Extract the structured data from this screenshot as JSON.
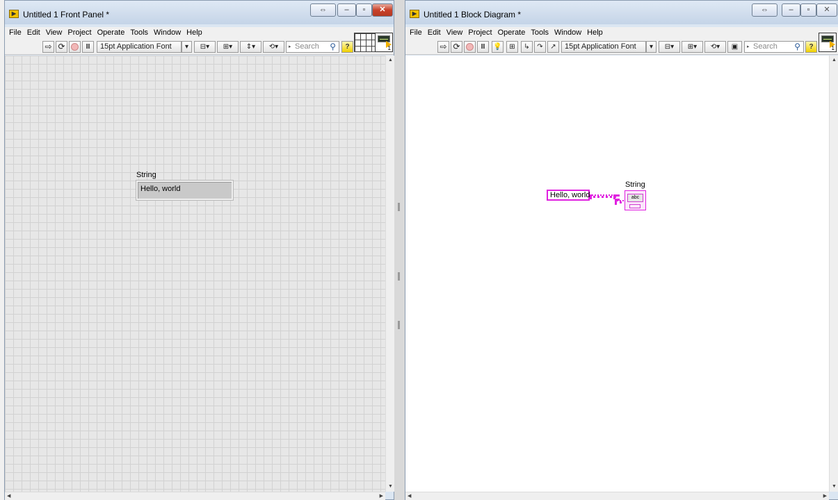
{
  "front_panel": {
    "title": "Untitled 1 Front Panel *",
    "menu": [
      "File",
      "Edit",
      "View",
      "Project",
      "Operate",
      "Tools",
      "Window",
      "Help"
    ],
    "toolbar": {
      "run_glyph": "⇨",
      "run_cont_glyph": "⟳",
      "pause_glyph": "II",
      "font": "15pt Application Font",
      "dropdown_glyph": "▾",
      "align_glyph": "⊟▾",
      "distribute_glyph": "⊞▾",
      "resize_glyph": "⇕▾",
      "reorder_glyph": "⟲▾",
      "search_placeholder": "Search",
      "help_glyph": "?"
    },
    "icon_number": "1",
    "window_controls": {
      "restore": "⇔",
      "minimize": "–",
      "maximize": "▫",
      "close": "✕"
    },
    "control": {
      "label": "String",
      "value": "Hello, world"
    }
  },
  "block_diagram": {
    "title": "Untitled 1 Block Diagram *",
    "menu": [
      "File",
      "Edit",
      "View",
      "Project",
      "Operate",
      "Tools",
      "Window",
      "Help"
    ],
    "toolbar": {
      "run_glyph": "⇨",
      "run_cont_glyph": "⟳",
      "pause_glyph": "II",
      "highlight_glyph": "💡",
      "retain_glyph": "⊞",
      "step_into_glyph": "↳",
      "step_over_glyph": "↷",
      "step_out_glyph": "↗",
      "font": "15pt Application Font",
      "dropdown_glyph": "▾",
      "align_glyph": "⊟▾",
      "distribute_glyph": "⊞▾",
      "reorder_glyph": "⟲▾",
      "cleanup_glyph": "▣",
      "search_placeholder": "Search",
      "help_glyph": "?"
    },
    "icon_number": "1",
    "window_controls": {
      "restore": "⇔",
      "minimize": "–",
      "maximize": "▫",
      "close": "✕"
    },
    "constant": {
      "value": "Hello, world"
    },
    "indicator": {
      "label": "String",
      "terminal_text": "abc"
    }
  }
}
